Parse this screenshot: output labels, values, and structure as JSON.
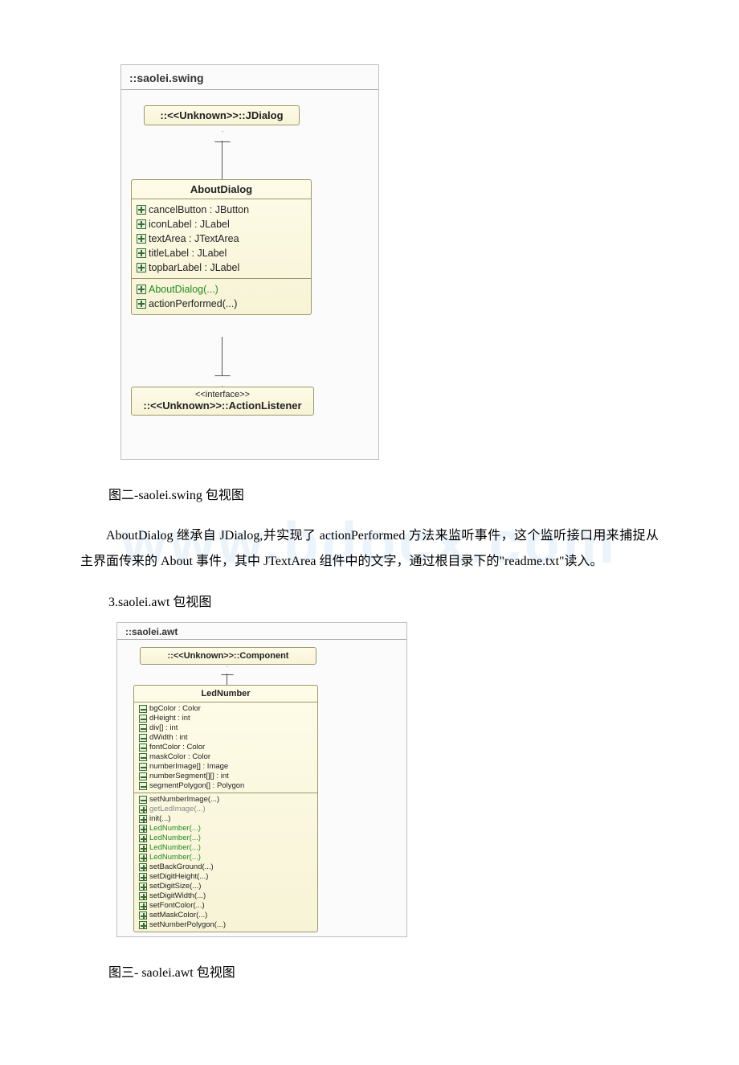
{
  "diagram1": {
    "package": "::saolei.swing",
    "parent": "::<<Unknown>>::JDialog",
    "className": "AboutDialog",
    "fields": [
      {
        "vis": "plus",
        "text": "cancelButton : JButton"
      },
      {
        "vis": "plus",
        "text": "iconLabel : JLabel"
      },
      {
        "vis": "plus",
        "text": "textArea : JTextArea"
      },
      {
        "vis": "plus",
        "text": "titleLabel : JLabel"
      },
      {
        "vis": "plus",
        "text": "topbarLabel : JLabel"
      }
    ],
    "methods": [
      {
        "vis": "plus",
        "text": "AboutDialog(...)",
        "cls": "green-text"
      },
      {
        "vis": "plus",
        "text": "actionPerformed(...)",
        "cls": ""
      }
    ],
    "iface_stereo": "<<interface>>",
    "iface": "::<<Unknown>>::ActionListener"
  },
  "caption1": "图二-saolei.swing 包视图",
  "paragraph1": "AboutDialog 继承自 JDialog,并实现了 actionPerformed 方法来监听事件，这个监听接口用来捕捉从主界面传来的 About 事件，其中 JTextArea 组件中的文字，通过根目录下的\"readme.txt\"读入。",
  "section3": "3.saolei.awt 包视图",
  "diagram2": {
    "package": "::saolei.awt",
    "parent": "::<<Unknown>>::Component",
    "className": "LedNumber",
    "fields": [
      {
        "vis": "minus",
        "text": "bgColor : Color"
      },
      {
        "vis": "minus",
        "text": "dHeight : int"
      },
      {
        "vis": "minus",
        "text": "div[] : int"
      },
      {
        "vis": "minus",
        "text": "dWidth : int"
      },
      {
        "vis": "minus",
        "text": "fontColor : Color"
      },
      {
        "vis": "minus",
        "text": "maskColor : Color"
      },
      {
        "vis": "minus",
        "text": "numberImage[] : Image"
      },
      {
        "vis": "minus",
        "text": "numberSegment[][] : int"
      },
      {
        "vis": "minus",
        "text": "segmentPolygon[] : Polygon"
      }
    ],
    "methods": [
      {
        "vis": "minus",
        "text": "setNumberImage(...)",
        "cls": ""
      },
      {
        "vis": "plus",
        "text": "getLedImage(...)",
        "cls": "grey-text"
      },
      {
        "vis": "plus",
        "text": "init(...)",
        "cls": ""
      },
      {
        "vis": "plus",
        "text": "LedNumber(...)",
        "cls": "green-text"
      },
      {
        "vis": "plus",
        "text": "LedNumber(...)",
        "cls": "green-text"
      },
      {
        "vis": "plus",
        "text": "LedNumber(...)",
        "cls": "green-text"
      },
      {
        "vis": "plus",
        "text": "LedNumber(...)",
        "cls": "green-text"
      },
      {
        "vis": "plus",
        "text": "setBackGround(...)",
        "cls": ""
      },
      {
        "vis": "plus",
        "text": "setDigitHeight(...)",
        "cls": ""
      },
      {
        "vis": "plus",
        "text": "setDigitSize(...)",
        "cls": ""
      },
      {
        "vis": "plus",
        "text": "setDigitWidth(...)",
        "cls": ""
      },
      {
        "vis": "plus",
        "text": "setFontColor(...)",
        "cls": ""
      },
      {
        "vis": "plus",
        "text": "setMaskColor(...)",
        "cls": ""
      },
      {
        "vis": "plus",
        "text": "setNumberPolygon(...)",
        "cls": ""
      }
    ]
  },
  "caption2": "图三- saolei.awt 包视图",
  "watermark": "www.bdocx.com"
}
